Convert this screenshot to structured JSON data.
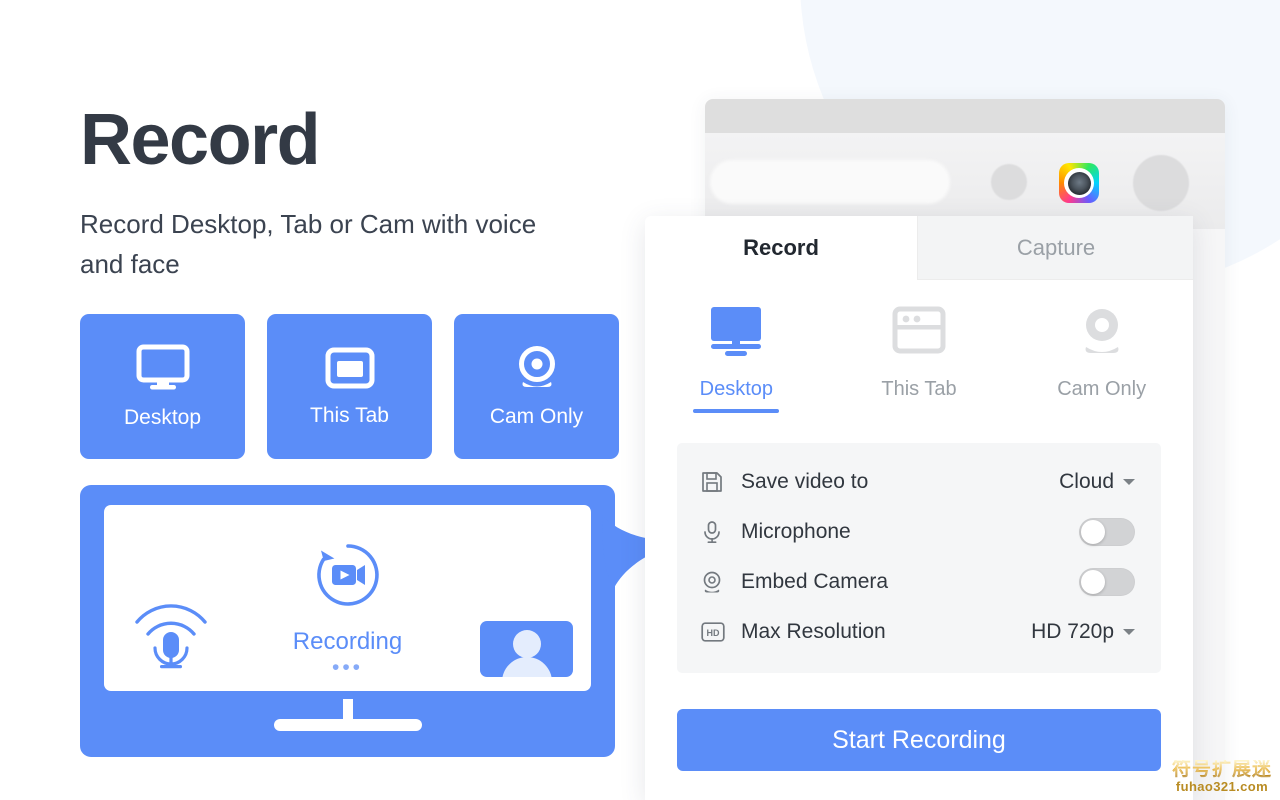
{
  "hero": {
    "headline": "Record",
    "subhead": "Record Desktop, Tab or Cam with voice and face",
    "modes": [
      {
        "label": "Desktop",
        "icon": "monitor-icon"
      },
      {
        "label": "This Tab",
        "icon": "window-icon"
      },
      {
        "label": "Cam Only",
        "icon": "webcam-icon"
      }
    ]
  },
  "illustration": {
    "status_label": "Recording",
    "status_dots": "•••",
    "mic_icon": "microphone-waves-icon",
    "video_icon": "video-refresh-icon",
    "camera_thumb_icon": "person-avatar-icon"
  },
  "browser": {
    "extension_icon": "camera-extension-icon"
  },
  "popup": {
    "tabs": [
      {
        "label": "Record",
        "active": true
      },
      {
        "label": "Capture",
        "active": false
      }
    ],
    "sources": [
      {
        "label": "Desktop",
        "icon": "monitor-icon",
        "active": true
      },
      {
        "label": "This Tab",
        "icon": "browser-window-icon",
        "active": false
      },
      {
        "label": "Cam Only",
        "icon": "webcam-icon",
        "active": false
      }
    ],
    "settings": [
      {
        "icon": "floppy-save-icon",
        "label": "Save video to",
        "control": "select",
        "value": "Cloud"
      },
      {
        "icon": "microphone-icon",
        "label": "Microphone",
        "control": "toggle",
        "value": "off"
      },
      {
        "icon": "webcam-icon",
        "label": "Embed Camera",
        "control": "toggle",
        "value": "off"
      },
      {
        "icon": "hd-badge-icon",
        "label": "Max Resolution",
        "control": "select",
        "value": "HD 720p"
      }
    ],
    "cta_label": "Start Recording"
  },
  "watermark": {
    "cn": "符号扩展迷",
    "en": "fuhao321.com"
  },
  "colors": {
    "accent": "#5b8df8",
    "headline": "#333a45",
    "muted": "#9aa0a6",
    "panel": "#f5f6f7"
  }
}
